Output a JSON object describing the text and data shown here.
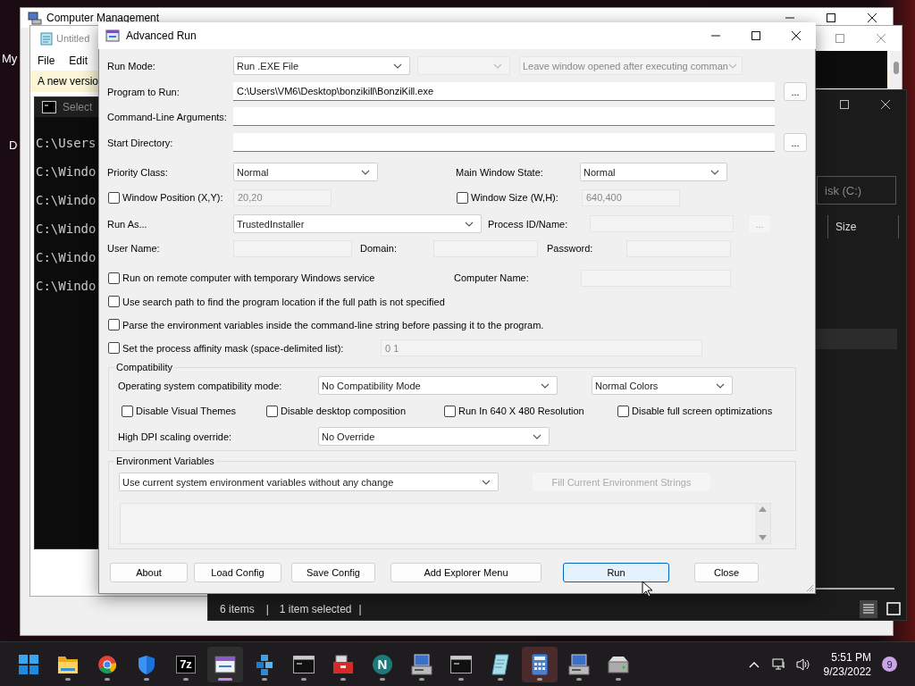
{
  "desktop": {
    "icon_labels": [
      "My",
      "D"
    ]
  },
  "background_windows": {
    "computer_management": {
      "title": "Computer Management"
    },
    "notepad": {
      "title": "Untitled",
      "menu": [
        "File",
        "Edit"
      ],
      "banner": "A new versio"
    },
    "console": {
      "title": "Select",
      "lines": [
        "C:\\Users",
        "C:\\Windo",
        "C:\\Windo",
        "C:\\Windo",
        "C:\\Windo",
        "C:\\Windo"
      ]
    },
    "explorer": {
      "address": "isk (C:)",
      "columns": [
        "Size"
      ],
      "status": [
        "6 items",
        "|",
        "1 item selected",
        "|"
      ]
    }
  },
  "dialog": {
    "title": "Advanced Run",
    "run_mode": {
      "label": "Run Mode:",
      "value": "Run .EXE File"
    },
    "run_mode_option": {
      "disabled": true
    },
    "leave_window": {
      "value": "Leave window opened after executing comman",
      "disabled": true
    },
    "program_to_run": {
      "label": "Program to Run:",
      "value": "C:\\Users\\VM6\\Desktop\\bonzikill\\BonziKill.exe",
      "browse": "..."
    },
    "command_line_arguments": {
      "label": "Command-Line Arguments:"
    },
    "start_directory": {
      "label": "Start Directory:",
      "browse": "..."
    },
    "priority_class": {
      "label": "Priority Class:",
      "value": "Normal"
    },
    "main_window_state": {
      "label": "Main Window State:",
      "value": "Normal"
    },
    "window_position": {
      "label": "Window Position (X,Y):",
      "checked": false,
      "value": "20,20"
    },
    "window_size": {
      "label": "Window Size (W,H):",
      "checked": false,
      "value": "640,400"
    },
    "run_as": {
      "label": "Run As...",
      "value": "TrustedInstaller"
    },
    "process_id": {
      "label": "Process ID/Name:",
      "browse": "...",
      "disabled": true
    },
    "user_name": {
      "label": "User Name:"
    },
    "domain": {
      "label": "Domain:"
    },
    "password": {
      "label": "Password:"
    },
    "options": [
      {
        "kind": "with_field",
        "label": "Run on remote computer with temporary Windows service",
        "checked": false,
        "field_label": "Computer Name:"
      },
      {
        "kind": "plain",
        "label": "Use search path to find the program location if the full path is not specified",
        "checked": false
      },
      {
        "kind": "plain",
        "label": "Parse the environment variables inside the command-line string before passing it to the program.",
        "checked": false
      },
      {
        "kind": "with_field",
        "label": "Set the process affinity mask (space-delimited list):",
        "checked": false,
        "value": "0 1"
      }
    ],
    "compatibility": {
      "title": "Compatibility",
      "os_mode_label": "Operating system compatibility mode:",
      "os_mode": "No Compatibility Mode",
      "colors": "Normal Colors",
      "checkboxes": [
        {
          "label": "Disable Visual Themes",
          "checked": false
        },
        {
          "label": "Disable desktop composition",
          "checked": false
        },
        {
          "label": "Run In 640 X 480 Resolution",
          "checked": false
        },
        {
          "label": "Disable full screen optimizations",
          "checked": false
        }
      ],
      "dpi_label": "High DPI scaling override:",
      "dpi": "No Override"
    },
    "environment": {
      "title": "Environment Variables",
      "mode": "Use current system environment variables without any change",
      "fill_button": {
        "label": "Fill Current Environment Strings",
        "disabled": true
      }
    },
    "buttons": [
      {
        "label": "About",
        "default": false
      },
      {
        "label": "Load Config",
        "default": false
      },
      {
        "label": "Save Config",
        "default": false
      },
      {
        "label": "Add Explorer Menu",
        "default": false
      },
      {
        "label": "Run",
        "default": true
      },
      {
        "label": "Close",
        "default": false
      }
    ]
  },
  "taskbar": {
    "apps": [
      {
        "kind": "start",
        "running": false,
        "selected": false,
        "attention": false
      },
      {
        "kind": "folder",
        "running": true,
        "selected": false,
        "attention": false
      },
      {
        "kind": "browser",
        "running": true,
        "selected": false,
        "attention": false
      },
      {
        "kind": "shield",
        "running": true,
        "selected": false,
        "attention": false
      },
      {
        "kind": "archive",
        "glyph": "7z",
        "running": true,
        "selected": false,
        "attention": false
      },
      {
        "kind": "runner",
        "running": true,
        "selected": true,
        "attention": false
      },
      {
        "kind": "cube",
        "running": true,
        "selected": false,
        "attention": false
      },
      {
        "kind": "console",
        "running": true,
        "selected": false,
        "attention": false
      },
      {
        "kind": "toolbox",
        "running": true,
        "selected": false,
        "attention": false
      },
      {
        "kind": "globe",
        "glyph": "N",
        "running": true,
        "selected": false,
        "attention": false
      },
      {
        "kind": "computer",
        "running": true,
        "selected": false,
        "attention": false
      },
      {
        "kind": "console",
        "running": true,
        "selected": false,
        "attention": false
      },
      {
        "kind": "notepad",
        "running": true,
        "selected": false,
        "attention": false
      },
      {
        "kind": "calculator",
        "running": true,
        "selected": false,
        "attention": true
      },
      {
        "kind": "computer",
        "running": true,
        "selected": false,
        "attention": false
      },
      {
        "kind": "drive",
        "running": true,
        "selected": false,
        "attention": false
      }
    ],
    "clock": {
      "time": "5:51 PM",
      "date": "9/23/2022"
    },
    "notifications": "9"
  }
}
